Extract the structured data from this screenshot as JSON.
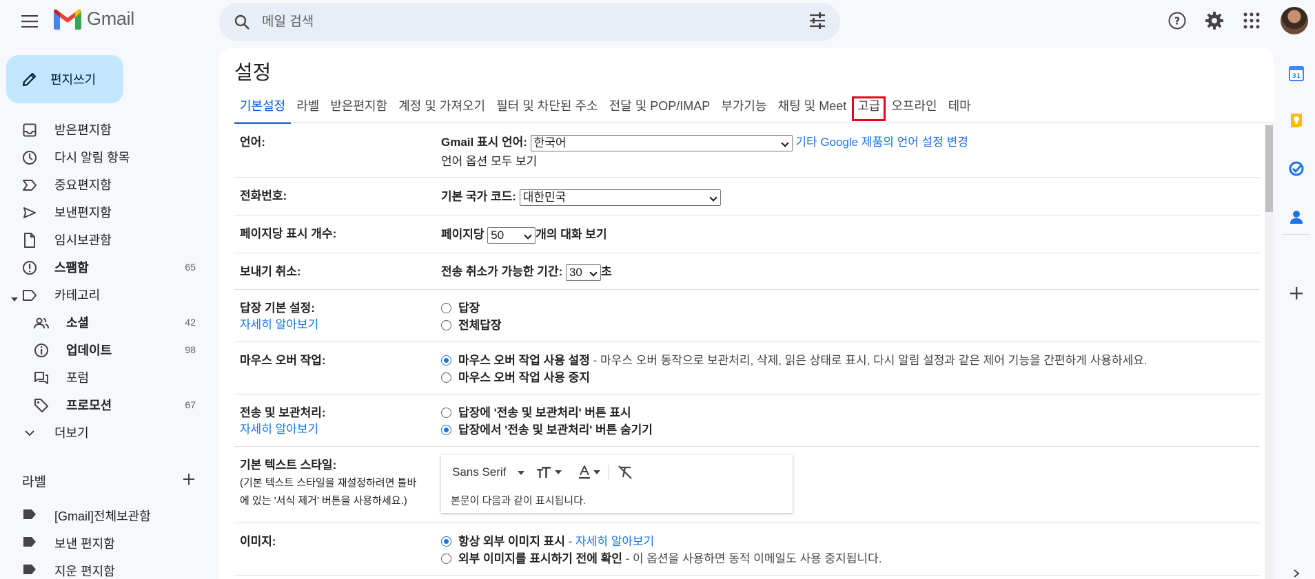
{
  "app": {
    "name": "Gmail"
  },
  "search": {
    "placeholder": "메일 검색"
  },
  "compose": {
    "label": "편지쓰기"
  },
  "nav": [
    {
      "label": "받은편지함",
      "count": "",
      "bold": false
    },
    {
      "label": "다시 알림 항목",
      "count": "",
      "bold": false
    },
    {
      "label": "중요편지함",
      "count": "",
      "bold": false
    },
    {
      "label": "보낸편지함",
      "count": "",
      "bold": false
    },
    {
      "label": "임시보관함",
      "count": "",
      "bold": false
    },
    {
      "label": "스팸함",
      "count": "65",
      "bold": true
    },
    {
      "label": "카테고리",
      "count": "",
      "bold": false
    }
  ],
  "categories": [
    {
      "label": "소셜",
      "count": "42",
      "bold": true
    },
    {
      "label": "업데이트",
      "count": "98",
      "bold": true
    },
    {
      "label": "포럼",
      "count": "",
      "bold": false
    },
    {
      "label": "프로모션",
      "count": "67",
      "bold": true
    }
  ],
  "more": {
    "label": "더보기"
  },
  "labels": {
    "heading": "라벨",
    "items": [
      "[Gmail]전체보관함",
      "보낸 편지함",
      "지운 편지함"
    ]
  },
  "settings": {
    "title": "설정",
    "tabs": [
      "기본설정",
      "라벨",
      "받은편지함",
      "계정 및 가져오기",
      "필터 및 차단된 주소",
      "전달 및 POP/IMAP",
      "부가기능",
      "채팅 및 Meet",
      "고급",
      "오프라인",
      "테마"
    ],
    "language": {
      "label": "언어:",
      "display_label": "Gmail 표시 언어:",
      "selected": "한국어",
      "other_link": "기타 Google 제품의 언어 설정 변경",
      "all_options_link": "언어 옵션 모두 보기"
    },
    "phone": {
      "label": "전화번호:",
      "country_label": "기본 국가 코드:",
      "country": "대한민국"
    },
    "page_size": {
      "label": "페이지당 표시 개수:",
      "prefix": "페이지당",
      "value": "50",
      "suffix": "개의 대화 보기"
    },
    "undo_send": {
      "label": "보내기 취소:",
      "prefix": "전송 취소가 가능한 기간:",
      "value": "30",
      "suffix": "초"
    },
    "reply": {
      "label": "답장 기본 설정:",
      "learn_more": "자세히 알아보기",
      "options": [
        "답장",
        "전체답장"
      ]
    },
    "hover": {
      "label": "마우스 오버 작업:",
      "on_label": "마우스 오버 작업 사용 설정",
      "on_desc": " - 마우스 오버 동작으로 보관처리, 삭제, 읽은 상태로 표시, 다시 알림 설정과 같은 제어 기능을 간편하게 사용하세요.",
      "off_label": "마우스 오버 작업 사용 중지"
    },
    "send_archive": {
      "label": "전송 및 보관처리:",
      "learn_more": "자세히 알아보기",
      "options": [
        "답장에 '전송 및 보관처리' 버튼 표시",
        "답장에서 '전송 및 보관처리' 버튼 숨기기"
      ]
    },
    "text_style": {
      "label": "기본 텍스트 스타일:",
      "note_line1": "(기본 텍스트 스타일을 재설정하려면 툴바",
      "note_line2": "에 있는 '서식 제거' 버튼을 사용하세요.)",
      "font": "Sans Serif",
      "preview": "본문이 다음과 같이 표시됩니다."
    },
    "images": {
      "label": "이미지:",
      "always_label": "항상 외부 이미지 표시",
      "always_link": "자세히 알아보기",
      "ask_label": "외부 이미지를 표시하기 전에 확인",
      "ask_desc": " - 이 옵션을 사용하면 동적 이메일도 사용 중지됩니다."
    }
  },
  "colors": {
    "accent": "#0b57d0",
    "highlight": "#e8001c",
    "compose_bg": "#c2e7ff"
  }
}
